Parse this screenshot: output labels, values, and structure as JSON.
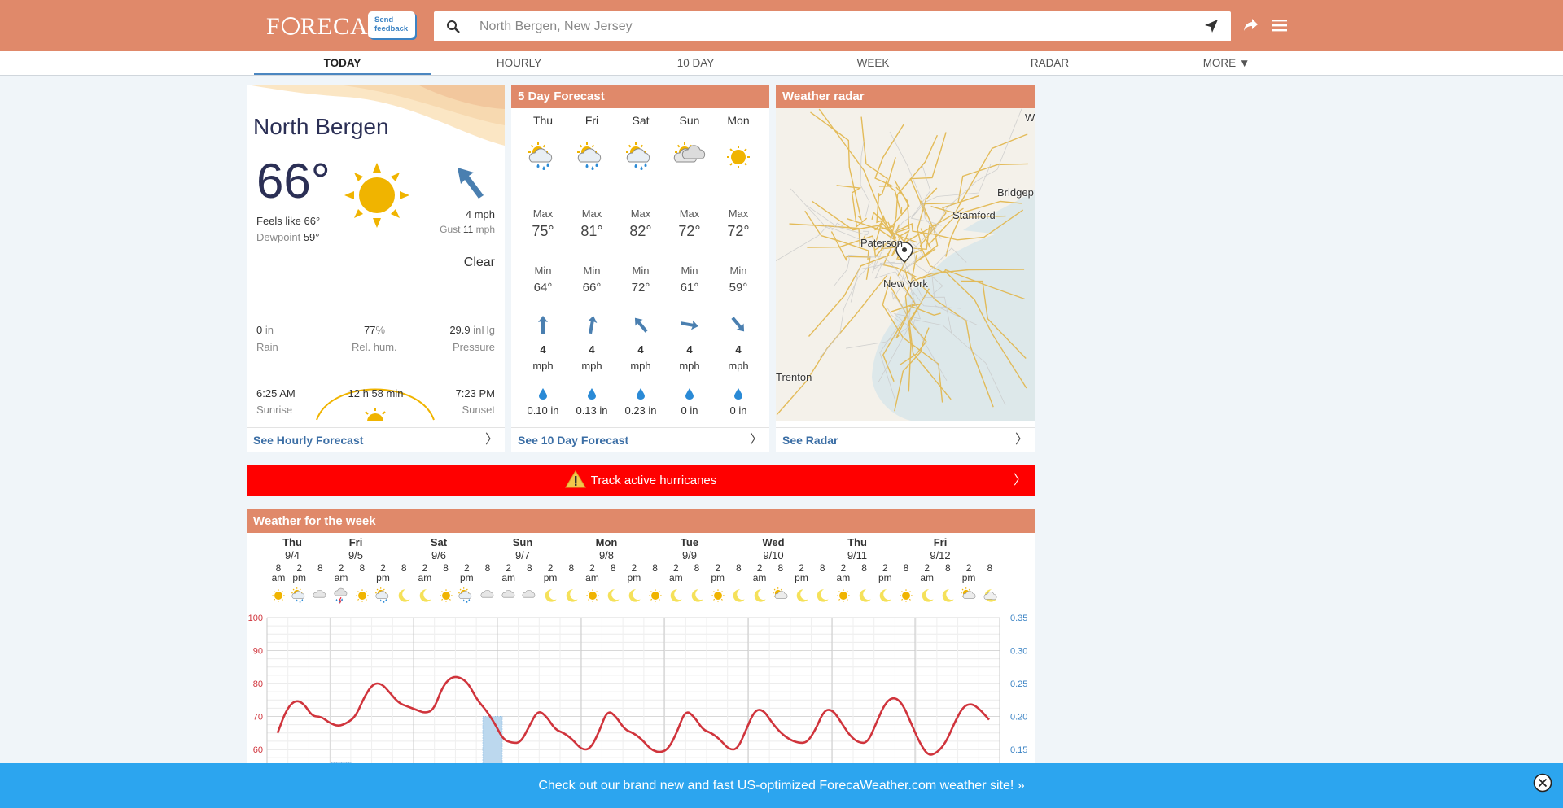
{
  "header": {
    "logo": "FORECA",
    "feedback": [
      "Send",
      "feedback"
    ],
    "search_placeholder": "North Bergen, New Jersey",
    "accent": "#e0896a"
  },
  "nav": {
    "tabs": [
      "TODAY",
      "HOURLY",
      "10 DAY",
      "WEEK",
      "RADAR",
      "MORE ▼"
    ],
    "active": "TODAY"
  },
  "today": {
    "city": "North Bergen",
    "temp": "66°",
    "feels_like": "Feels like 66°",
    "dewpoint_label": "Dewpoint",
    "dewpoint": "59°",
    "wind": "4 mph",
    "gust_label": "Gust",
    "gust_value": "11",
    "gust_unit": "mph",
    "condition": "Clear",
    "rain_value": "0",
    "rain_unit": "in",
    "rain_label": "Rain",
    "humidity_value": "77",
    "humidity_unit": "%",
    "humidity_label": "Rel. hum.",
    "pressure_value": "29.9",
    "pressure_unit": "inHg",
    "pressure_label": "Pressure",
    "sunrise": "6:25 AM",
    "sunrise_label": "Sunrise",
    "day_length": "12 h 58 min",
    "sunset": "7:23 PM",
    "sunset_label": "Sunset",
    "footer": "See Hourly Forecast"
  },
  "five_day": {
    "title": "5 Day Forecast",
    "max_label": "Max",
    "min_label": "Min",
    "wind_unit": "mph",
    "footer": "See 10 Day Forecast",
    "days": [
      {
        "day": "Thu",
        "icon": "sun-rain-icon",
        "max": "75°",
        "min": "64°",
        "wind": "4",
        "rain": "0.10 in",
        "wind_dir": 0
      },
      {
        "day": "Fri",
        "icon": "sun-rain-icon",
        "max": "81°",
        "min": "66°",
        "wind": "4",
        "rain": "0.13 in",
        "wind_dir": 10
      },
      {
        "day": "Sat",
        "icon": "sun-rain-icon",
        "max": "82°",
        "min": "72°",
        "wind": "4",
        "rain": "0.23 in",
        "wind_dir": -40
      },
      {
        "day": "Sun",
        "icon": "cloudy-icon",
        "max": "72°",
        "min": "61°",
        "wind": "4",
        "rain": "0 in",
        "wind_dir": 100
      },
      {
        "day": "Mon",
        "icon": "sun-icon",
        "max": "72°",
        "min": "59°",
        "wind": "4",
        "rain": "0 in",
        "wind_dir": 140
      }
    ]
  },
  "radar": {
    "title": "Weather radar",
    "labels": [
      "Paterson",
      "New York",
      "Stamford",
      "Bridgep",
      "Trenton",
      "W"
    ],
    "footer": "See Radar"
  },
  "hurricane": {
    "text": "Track active hurricanes",
    "color": "#ff0000"
  },
  "week": {
    "title": "Weather for the week",
    "days": [
      {
        "day": "Thu",
        "date": "9/4"
      },
      {
        "day": "Fri",
        "date": "9/5"
      },
      {
        "day": "Sat",
        "date": "9/6"
      },
      {
        "day": "Sun",
        "date": "9/7"
      },
      {
        "day": "Mon",
        "date": "9/8"
      },
      {
        "day": "Tue",
        "date": "9/9"
      },
      {
        "day": "Wed",
        "date": "9/10"
      },
      {
        "day": "Thu",
        "date": "9/11"
      },
      {
        "day": "Fri",
        "date": "9/12"
      }
    ],
    "hour_labels": [
      [
        "8",
        "am"
      ],
      [
        "2",
        "pm"
      ],
      [
        "8",
        ""
      ],
      [
        "2",
        "am"
      ],
      [
        "8",
        ""
      ],
      [
        "2",
        "pm"
      ],
      [
        "8",
        ""
      ],
      [
        "2",
        "am"
      ],
      [
        "8",
        ""
      ],
      [
        "2",
        "pm"
      ],
      [
        "8",
        ""
      ],
      [
        "2",
        "am"
      ],
      [
        "8",
        ""
      ],
      [
        "2",
        "pm"
      ],
      [
        "8",
        ""
      ],
      [
        "2",
        "am"
      ],
      [
        "8",
        ""
      ],
      [
        "2",
        "pm"
      ],
      [
        "8",
        ""
      ],
      [
        "2",
        "am"
      ],
      [
        "8",
        ""
      ],
      [
        "2",
        "pm"
      ],
      [
        "8",
        ""
      ],
      [
        "2",
        "am"
      ],
      [
        "8",
        ""
      ],
      [
        "2",
        "pm"
      ],
      [
        "8",
        ""
      ],
      [
        "2",
        "am"
      ],
      [
        "8",
        ""
      ],
      [
        "2",
        "pm"
      ],
      [
        "8",
        ""
      ],
      [
        "2",
        "am"
      ],
      [
        "8",
        ""
      ],
      [
        "2",
        "pm"
      ],
      [
        "8",
        ""
      ]
    ],
    "hour_icons": [
      "sun",
      "sun-rain",
      "cloud",
      "storm",
      "sun",
      "sun-rain",
      "moon",
      "moon",
      "sun",
      "sun-rain",
      "cloud",
      "cloud",
      "cloud",
      "moon",
      "moon",
      "sun",
      "moon",
      "moon",
      "sun",
      "moon",
      "moon",
      "sun",
      "moon",
      "moon",
      "sun-cloud",
      "moon",
      "moon",
      "sun",
      "moon",
      "moon",
      "sun",
      "moon",
      "moon",
      "sun-cloud",
      "cloud-moon"
    ]
  },
  "chart_data": {
    "type": "line",
    "temp_axis": {
      "ticks": [
        100,
        90,
        80,
        70,
        60
      ],
      "color": "#d0343c"
    },
    "precip_axis": {
      "ticks": [
        "0.35",
        "0.30",
        "0.25",
        "0.20",
        "0.15"
      ],
      "color": "#3b83c4"
    },
    "series": [
      {
        "values": [
          65,
          72,
          75,
          74,
          70,
          70,
          68,
          67,
          68,
          70,
          76,
          80,
          80,
          77,
          74,
          73,
          72,
          71,
          72,
          79,
          82,
          82,
          80,
          75,
          72,
          68,
          63,
          62,
          62,
          67,
          72,
          70,
          66,
          65,
          63,
          60,
          60,
          65,
          72,
          70,
          66,
          65,
          63,
          60,
          59,
          60,
          65,
          72,
          70,
          66,
          65,
          63,
          60,
          60,
          66,
          72,
          72,
          68,
          65,
          63,
          62,
          62,
          66,
          72,
          72,
          68,
          64,
          62,
          62,
          68,
          74,
          76,
          74,
          68,
          62,
          58,
          59,
          62,
          68,
          73,
          74,
          72,
          69
        ]
      }
    ],
    "precip_bars": [
      {
        "day_index": 1,
        "value": 0.13
      },
      {
        "day_index": 3,
        "value": 0.2
      }
    ]
  },
  "banner": {
    "text": "Check out our brand new and fast US-optimized ForecaWeather.com weather site! »"
  }
}
